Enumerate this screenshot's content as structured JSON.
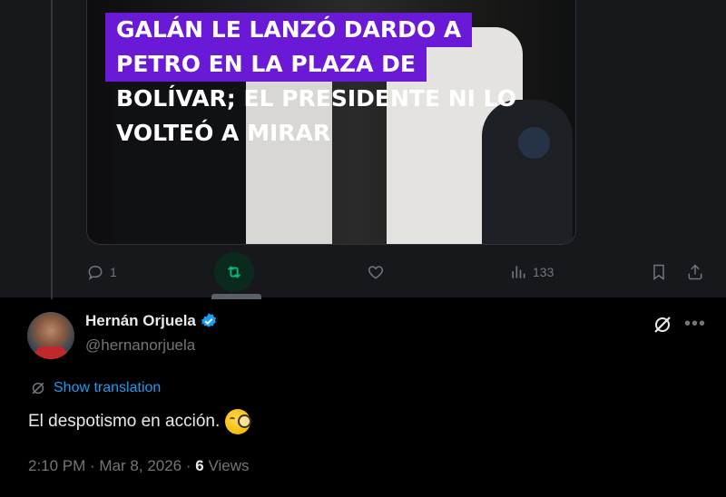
{
  "previous_tweet": {
    "media_headline_lines": [
      "GALÁN LE LANZÓ DARDO A",
      "PETRO EN LA PLAZA DE",
      "BOLÍVAR; EL PRESIDENTE NI LO",
      "VOLTEÓ A MIRAR"
    ],
    "actions": {
      "replies": "1",
      "views": "133"
    },
    "tooltip": "Repost"
  },
  "tweet": {
    "author_name": "Hernán Orjuela",
    "handle": "@hernanorjuela",
    "show_translation": "Show translation",
    "text": "El despotismo en acción.",
    "emoji": "face-with-monocle",
    "time": "2:10 PM",
    "separator1": " · ",
    "date": "Mar 8, 2026",
    "separator2": " · ",
    "views_count": "6",
    "views_label": " Views"
  },
  "colors": {
    "accent_blue": "#1d9bf0",
    "repost_green": "#00ba7c",
    "headline_purple": "#6a1ad6"
  }
}
